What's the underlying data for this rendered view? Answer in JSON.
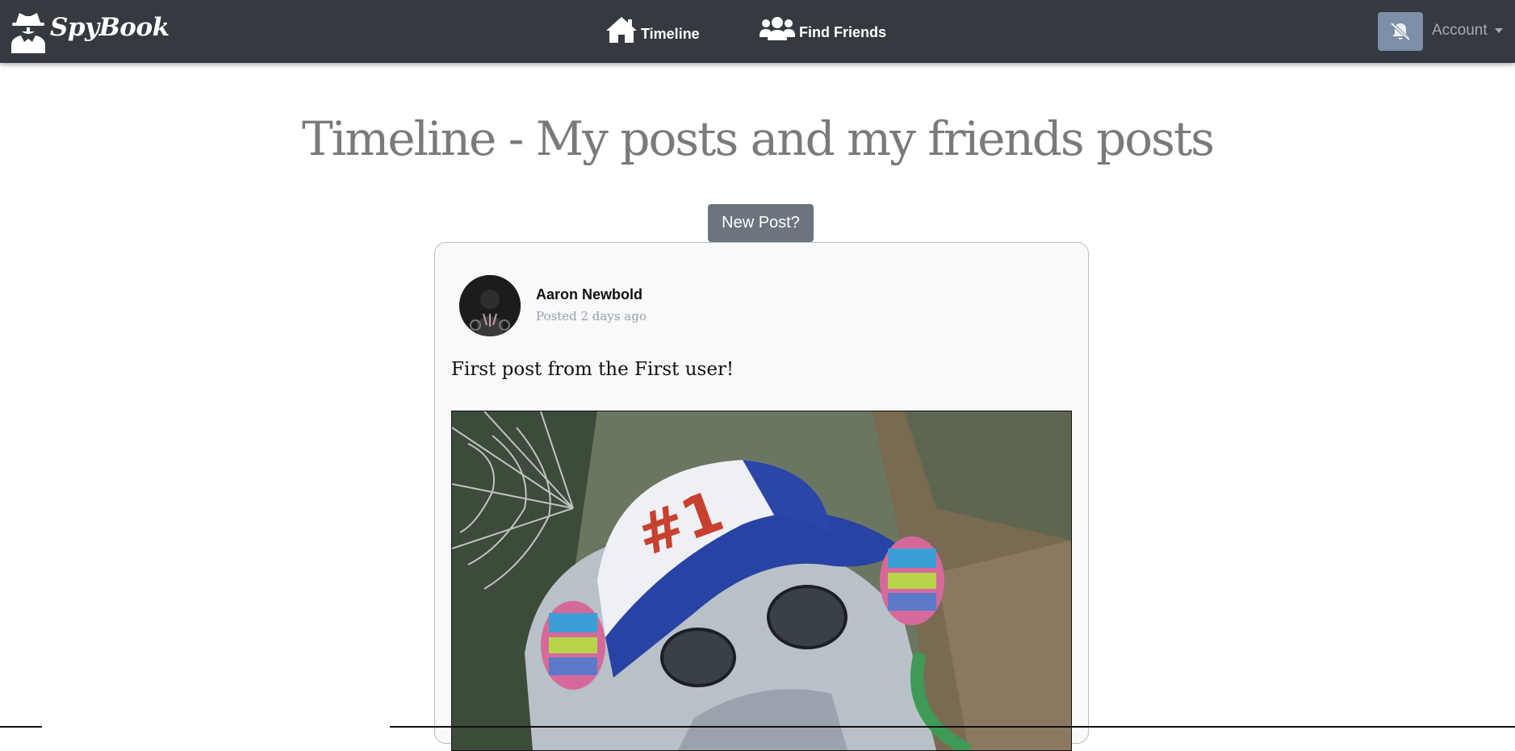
{
  "navbar": {
    "brand": "SpyBook",
    "links": [
      {
        "label": "Timeline",
        "icon": "home-icon"
      },
      {
        "label": "Find Friends",
        "icon": "users-icon"
      }
    ],
    "notifications_icon": "bell-slash-icon",
    "account_label": "Account"
  },
  "page": {
    "title": "Timeline - My posts and my friends posts",
    "new_post_label": "New Post?"
  },
  "posts": [
    {
      "author": "Aaron Newbold",
      "posted": "Posted 2 days ago",
      "text": "First post from the First user!",
      "image_icon": "post-image"
    }
  ],
  "colors": {
    "navbar": "#343a40",
    "notification_button": "#7d8fa6",
    "new_post_button": "#6c757d",
    "card_background": "#f8f9fa",
    "title": "#7a7a7a"
  }
}
